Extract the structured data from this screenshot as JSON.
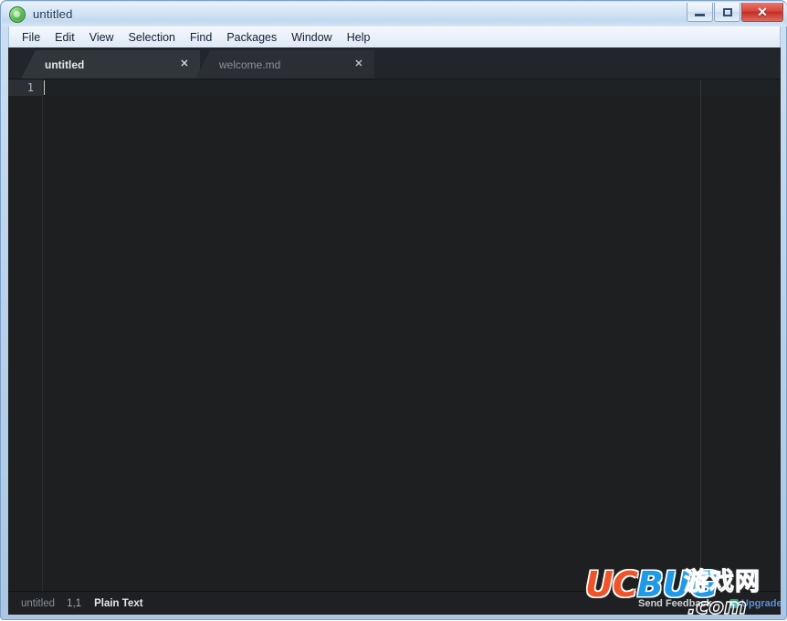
{
  "window": {
    "title": "untitled",
    "icon": "atom-app-icon",
    "buttons": {
      "minimize_label": "–",
      "maximize_label": "□",
      "close_label": "✕"
    }
  },
  "menu": {
    "items": [
      {
        "label": "File"
      },
      {
        "label": "Edit"
      },
      {
        "label": "View"
      },
      {
        "label": "Selection"
      },
      {
        "label": "Find"
      },
      {
        "label": "Packages"
      },
      {
        "label": "Window"
      },
      {
        "label": "Help"
      }
    ]
  },
  "tabs": [
    {
      "label": "untitled",
      "close_label": "✕",
      "active": true
    },
    {
      "label": "welcome.md",
      "close_label": "✕",
      "active": false
    }
  ],
  "editor": {
    "line_numbers": [
      "1"
    ],
    "content": "",
    "theme_background": "#1d1f21",
    "wrap_guide_color": "#34373b"
  },
  "status_bar": {
    "file_name": "untitled",
    "cursor_position": "1,1",
    "grammar": "Plain Text",
    "feedback_label": "Send Feedback",
    "upgrade_label": "Upgrade"
  },
  "watermark": {
    "logo_uc": "UC",
    "logo_bug": "BUG",
    "chinese": "游戏网",
    "domain": ".com",
    "color_uc": "#f0522a",
    "color_bug": "#1e9ae8"
  }
}
